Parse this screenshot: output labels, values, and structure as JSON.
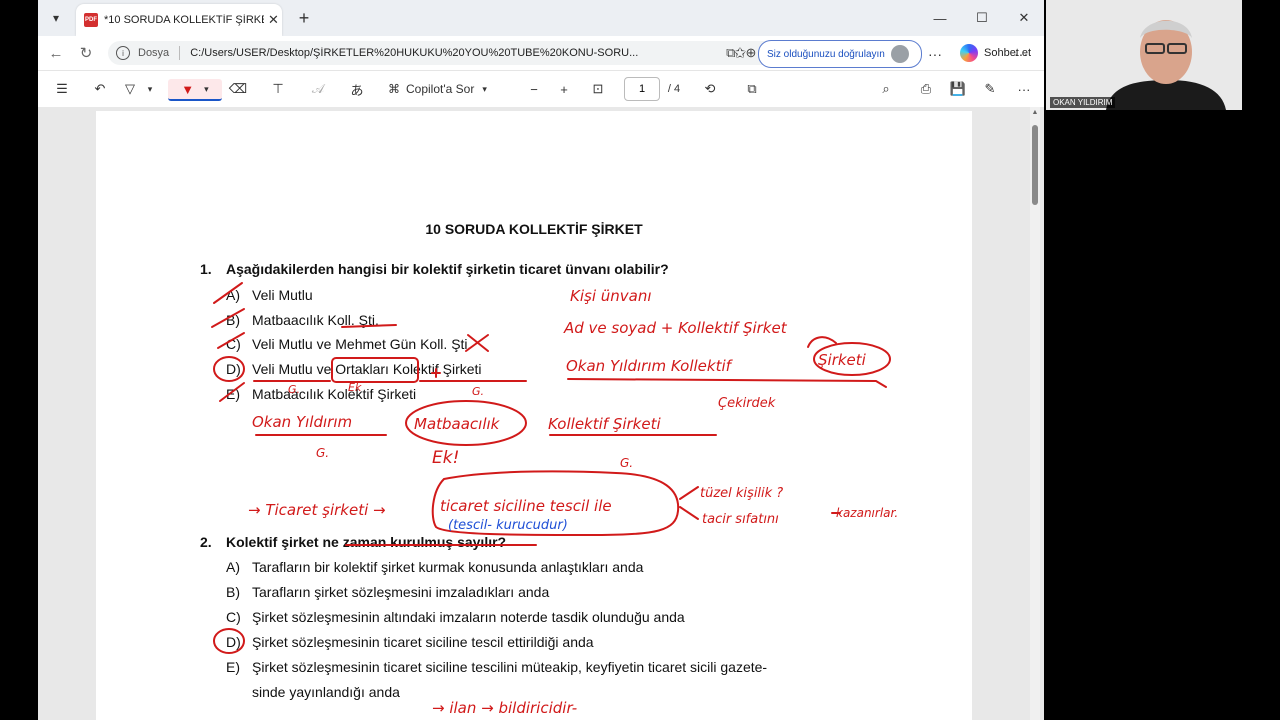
{
  "browser": {
    "tab_title": "*10 SORUDA KOLLEKTİF ŞİRKET Ç...",
    "url_prefix": "Dosya",
    "url": "C:/Users/USER/Desktop/ŞİRKETLER%20HUKUKU%20YOU%20TUBE%20KONU-SORU...",
    "verify_label": "Siz olduğunuzu doğrulayın",
    "copilot_label": "Sohbet et"
  },
  "pdf_toolbar": {
    "copilot_label": "Copilot'a Sor",
    "page_current": "1",
    "page_total": "/ 4",
    "read_aloud_glyph": "𝒜"
  },
  "document": {
    "title": "10 SORUDA KOLLEKTİF ŞİRKET",
    "q1": {
      "number": "1.",
      "text": "Aşağıdakilerden hangisi bir kolektif şirketin ticaret ünvanı olabilir?",
      "options": [
        {
          "letter": "A)",
          "text": "Veli Mutlu"
        },
        {
          "letter": "B)",
          "text": "Matbaacılık Koll. Şti."
        },
        {
          "letter": "C)",
          "text": "Veli Mutlu ve Mehmet Gün Koll. Şti."
        },
        {
          "letter": "D)",
          "text": "Veli Mutlu ve Ortakları Kolektif Şirketi"
        },
        {
          "letter": "E)",
          "text": "Matbaacılık Kolektif Şirketi"
        }
      ]
    },
    "q2": {
      "number": "2.",
      "text": "Kolektif şirket ne zaman kurulmuş sayılır?",
      "options": [
        {
          "letter": "A)",
          "text": "Tarafların bir kolektif şirket kurmak konusunda anlaştıkları anda"
        },
        {
          "letter": "B)",
          "text": "Tarafların şirket sözleşmesini imzaladıkları anda"
        },
        {
          "letter": "C)",
          "text": "Şirket sözleşmesinin altındaki imzaların noterde tasdik olunduğu anda"
        },
        {
          "letter": "D)",
          "text": "Şirket sözleşmesinin ticaret siciline tescil ettirildiği anda"
        },
        {
          "letter": "E)",
          "text": "Şirket sözleşmesinin ticaret siciline tescilini müteakip, keyfiyetin ticaret sicili gazete-"
        }
      ],
      "option_e_cont": "sinde yayınlandığı anda"
    }
  },
  "annotations": {
    "kisi_unvani": "Kişi ünvanı",
    "ad_soyad": "Ad ve soyad + Kollektif Şirket",
    "okan_line": "Okan Yıldırım Kollektif",
    "sirketi": "Şirketi",
    "cekirdek": "Çekirdek",
    "okan2": "Okan Yıldırım",
    "matbaacilik": "Matbaacılık",
    "kollektif_sirketi": "Kollektif Şirketi",
    "ek": "Ek",
    "ek2": "Ek!",
    "g": "G.",
    "ticaret_sirketi": "→ Ticaret şirketi →",
    "tescil_ile": "ticaret siciline tescil ile",
    "tescil_kurucu": "(tescil- kurucudur)",
    "tuzel_kisilik": "tüzel kişilik ?",
    "tacir_sifati": "tacir sıfatını",
    "kazanirlar": "kazanırlar.",
    "ilan": "→ ilan → bildiricidir-"
  },
  "webcam": {
    "name": "OKAN YILDIRIM"
  },
  "colors": {
    "ink_red": "#d11a1a",
    "ink_blue": "#1e4fd6",
    "accent": "#1a56c8"
  }
}
